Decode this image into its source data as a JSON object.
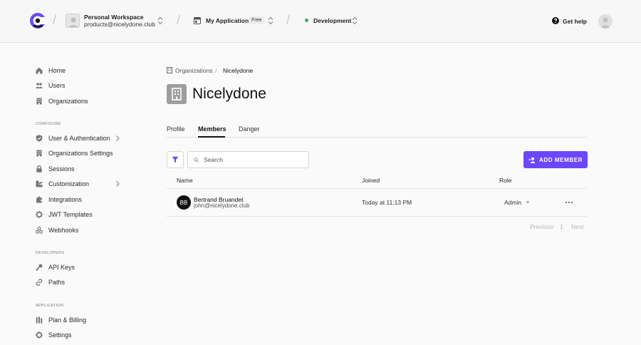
{
  "header": {
    "workspace_name": "Personal Workspace",
    "workspace_email": "products@nicelydone.club",
    "app_name": "My Application",
    "app_plan_badge": "Free",
    "environment": "Development",
    "help_label": "Get help"
  },
  "sidebar": {
    "top_items": [
      {
        "label": "Home",
        "icon": "home-icon"
      },
      {
        "label": "Users",
        "icon": "users-icon"
      },
      {
        "label": "Organizations",
        "icon": "building-icon"
      }
    ],
    "configure_title": "CONFIGURE",
    "configure_items": [
      {
        "label": "User & Authentication",
        "icon": "shield-icon"
      },
      {
        "label": "Organizations Settings",
        "icon": "building-icon"
      },
      {
        "label": "Sessions",
        "icon": "lock-icon"
      },
      {
        "label": "Customization",
        "icon": "brush-icon"
      },
      {
        "label": "Integrations",
        "icon": "puzzle-icon"
      },
      {
        "label": "JWT Templates",
        "icon": "gear-icon"
      },
      {
        "label": "Webhooks",
        "icon": "webhook-icon"
      }
    ],
    "developers_title": "DEVELOPERS",
    "developers_items": [
      {
        "label": "API Keys",
        "icon": "key-icon"
      },
      {
        "label": "Paths",
        "icon": "link-icon"
      }
    ],
    "application_title": "APPLICATION",
    "application_items": [
      {
        "label": "Plan & Billing",
        "icon": "billing-icon"
      },
      {
        "label": "Settings",
        "icon": "gear-icon"
      }
    ]
  },
  "main": {
    "breadcrumb_parent": "Organizations",
    "breadcrumb_separator": "/",
    "breadcrumb_current": "Nicelydone",
    "page_title": "Nicelydone",
    "tabs": [
      {
        "label": "Profile",
        "active": false
      },
      {
        "label": "Members",
        "active": true
      },
      {
        "label": "Danger",
        "active": false
      }
    ],
    "search_placeholder": "Search",
    "add_member_label": "ADD MEMBER",
    "table": {
      "columns": [
        "Name",
        "Joined",
        "Role"
      ],
      "rows": [
        {
          "initials": "BB",
          "name": "Bertrand Bruandet",
          "email": "john@nicelydone.club",
          "joined": "Today at 11:13 PM",
          "role": "Admin"
        }
      ]
    },
    "pagination": {
      "previous": "Previous",
      "page": "1",
      "next": "Next"
    }
  },
  "colors": {
    "accent": "#6c47ff",
    "environment_dot": "#3cb44b"
  }
}
